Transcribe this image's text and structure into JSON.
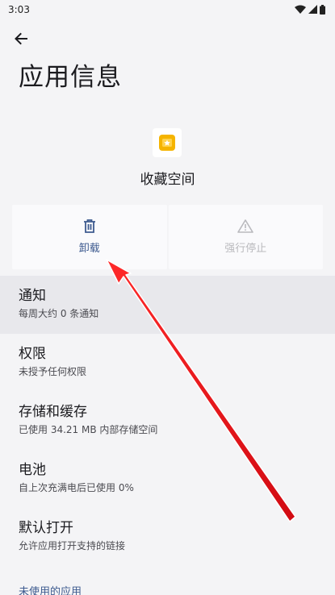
{
  "status_bar": {
    "time": "3:03",
    "icons": [
      "wifi-icon",
      "signal-icon",
      "battery-icon"
    ]
  },
  "header": {
    "back_icon": "arrow-back-icon",
    "title": "应用信息"
  },
  "app": {
    "icon": "app-star-icon",
    "name": "收藏空间",
    "icon_color": "#f5b400"
  },
  "actions": {
    "uninstall": {
      "label": "卸载",
      "icon": "trash-icon"
    },
    "force_stop": {
      "label": "强行停止",
      "icon": "warning-icon"
    }
  },
  "settings": [
    {
      "title": "通知",
      "subtitle": "每周大约 0 条通知"
    },
    {
      "title": "权限",
      "subtitle": "未授予任何权限"
    },
    {
      "title": "存储和缓存",
      "subtitle": "已使用 34.21 MB 内部存储空间"
    },
    {
      "title": "电池",
      "subtitle": "自上次充满电后已使用 0%"
    },
    {
      "title": "默认打开",
      "subtitle": "允许应用打开支持的链接"
    }
  ],
  "section": {
    "label": "未使用的应用"
  },
  "colors": {
    "accent": "#3d5a8f",
    "annotation_arrow": "#e8131b",
    "background": "#f4f4f6"
  }
}
